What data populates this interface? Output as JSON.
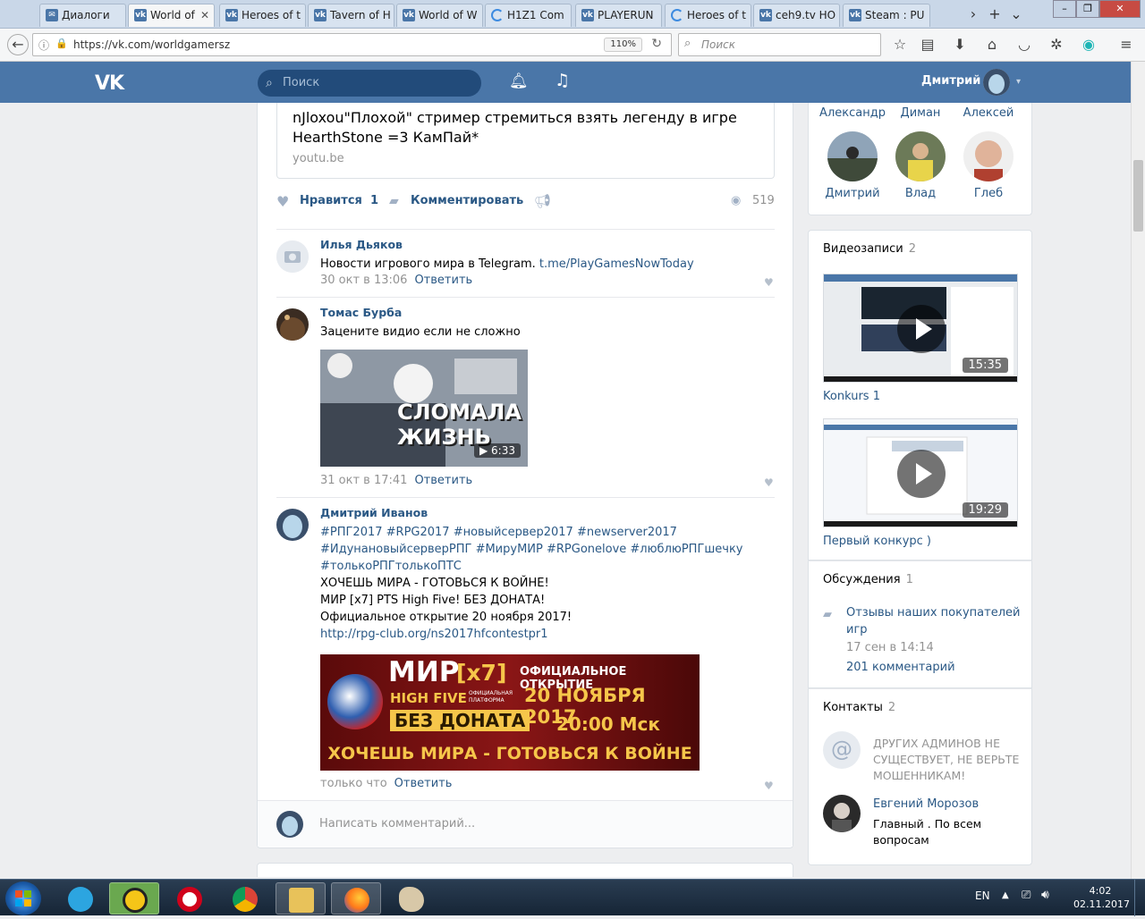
{
  "browser": {
    "tabs": [
      {
        "label": "Диалоги",
        "active": false
      },
      {
        "label": "World of",
        "active": true
      },
      {
        "label": "Heroes of t",
        "active": false
      },
      {
        "label": "Tavern of H",
        "active": false
      },
      {
        "label": "World of W",
        "active": false
      },
      {
        "label": "H1Z1 Com",
        "active": false
      },
      {
        "label": "PLAYERUN",
        "active": false
      },
      {
        "label": "Heroes of t",
        "active": false
      },
      {
        "label": "ceh9.tv HO",
        "active": false
      },
      {
        "label": "Steam : PU",
        "active": false
      }
    ],
    "url": "https://vk.com/worldgamersz",
    "zoom": "110%",
    "search_placeholder": "Поиск"
  },
  "vk": {
    "logo": "VK",
    "search_placeholder": "Поиск",
    "user_name": "Дмитрий"
  },
  "post": {
    "link_title": "nJloxou\"Плохой\" стример стремиться взять легенду в игре HearthStone =3 КамПай*",
    "link_source": "youtu.be",
    "like_label": "Нравится",
    "like_count": "1",
    "comment_label": "Комментировать",
    "views": "519"
  },
  "comments": [
    {
      "name": "Илья Дьяков",
      "text": "Новости игрового мира в Telegram. ",
      "link": "t.me/PlayGamesNowToday",
      "time": "30 окт в 13:06",
      "reply": "Ответить"
    },
    {
      "name": "Томас Бурба",
      "text": "Зацените видио если не сложно",
      "video_caption": "СЛОМАЛА ЖИЗНЬ",
      "video_duration": "6:33",
      "time": "31 окт в 17:41",
      "reply": "Ответить"
    },
    {
      "name": "Дмитрий Иванов",
      "hashtags": [
        "#РПГ2017 #RPG2017 #новыйсервер2017 #newserver2017",
        "#ИдунановыйсерверРПГ #МируМИР #RPGonelove #люблюРПГшечку",
        "#толькоРПГтолькоПТС"
      ],
      "lines": [
        "ХОЧЕШЬ МИРА - ГОТОВЬСЯ К ВОЙНЕ!",
        "МИР [x7] PTS High Five! БЕЗ ДОНАТА!",
        "Официальное открытие 20 ноября 2017!"
      ],
      "link": "http://rpg-club.org/ns2017hfcontestpr1",
      "banner": {
        "title": "МИР",
        "rate": "[x7]",
        "sub": "HIGH FIVE",
        "platform": "ОФИЦИАЛЬНАЯ ПЛАТФОРМА",
        "nodonate": "БЕЗ ДОНАТА",
        "open": "ОФИЦИАЛЬНОЕ ОТКРЫТИЕ",
        "date": "20 НОЯБРЯ 2017",
        "time": "20:00 Мск",
        "slogan": "ХОЧЕШЬ МИРА - ГОТОВЬСЯ К ВОЙНЕ"
      },
      "time": "только что",
      "reply": "Ответить"
    }
  ],
  "write_comment_placeholder": "Написать комментарий...",
  "sidebar": {
    "friends_top": [
      "Александр",
      "Диман",
      "Алексей"
    ],
    "friends": [
      "Дмитрий",
      "Влад",
      "Глеб"
    ],
    "videos": {
      "title": "Видеозаписи",
      "count": "2",
      "items": [
        {
          "title": "Konkurs 1",
          "duration": "15:35"
        },
        {
          "title": "Первый конкурс )",
          "duration": "19:29"
        }
      ]
    },
    "discussions": {
      "title": "Обсуждения",
      "count": "1",
      "topic": "Отзывы наших покупателей игр",
      "date": "17 сен в 14:14",
      "comments": "201 комментарий"
    },
    "contacts": {
      "title": "Контакты",
      "count": "2",
      "items": [
        {
          "name": "ДРУГИХ АДМИНОВ НЕ СУЩЕСТВУЕТ, НЕ ВЕРЬТЕ МОШЕННИКАМ!",
          "role": ""
        },
        {
          "name": "Евгений Морозов",
          "role": "Главный . По всем вопросам"
        }
      ]
    }
  },
  "taskbar": {
    "lang": "EN",
    "time": "4:02",
    "date": "02.11.2017"
  },
  "colors": {
    "vk_blue": "#4a76a8",
    "link": "#2a5885",
    "muted": "#939393"
  }
}
